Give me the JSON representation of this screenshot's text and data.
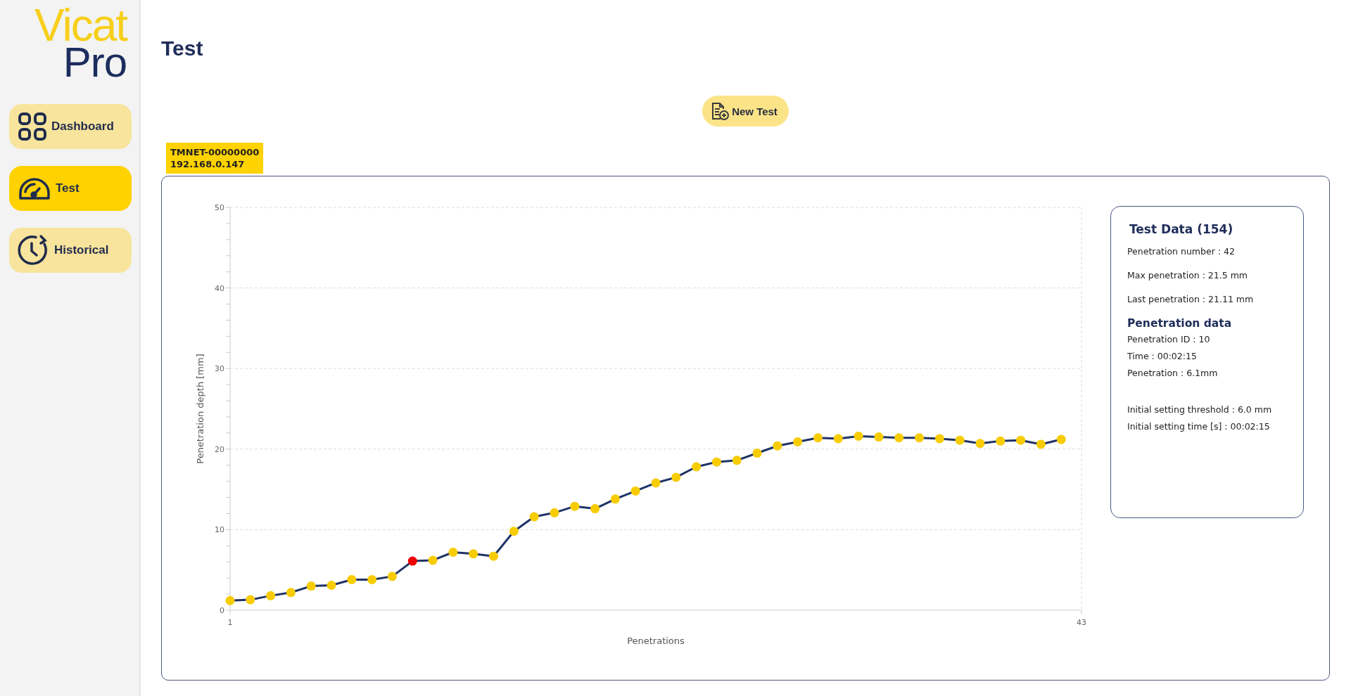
{
  "logo": {
    "line_1": "Vicat",
    "line_2": "Pro"
  },
  "sidebar": {
    "items": [
      {
        "label": "Dashboard",
        "selected": false
      },
      {
        "label": "Test",
        "selected": true
      },
      {
        "label": "Historical",
        "selected": false
      }
    ]
  },
  "page": {
    "title": "Test",
    "new_test_button": "New Test"
  },
  "device": {
    "name": "TMNET-00000000",
    "ip": "192.168.0.147"
  },
  "chart": {
    "chart_data": {
      "type": "line",
      "xlabel": "Penetrations",
      "ylabel": "Penetration depth [mm]",
      "x": [
        1,
        2,
        3,
        4,
        5,
        6,
        7,
        8,
        9,
        10,
        11,
        12,
        13,
        14,
        15,
        16,
        17,
        18,
        19,
        20,
        21,
        22,
        23,
        24,
        25,
        26,
        27,
        28,
        29,
        30,
        31,
        32,
        33,
        34,
        35,
        36,
        37,
        38,
        39,
        40,
        41,
        42
      ],
      "series": [
        {
          "color": "#1f3366",
          "marker": "circle",
          "values": [
            1.2,
            1.3,
            1.8,
            2.2,
            3.0,
            3.1,
            3.8,
            3.8,
            4.2,
            6.1,
            6.2,
            7.2,
            7.0,
            6.7,
            9.8,
            11.6,
            12.1,
            12.9,
            12.6,
            13.8,
            14.8,
            15.8,
            16.5,
            17.8,
            18.4,
            18.6,
            19.5,
            20.4,
            20.9,
            21.4,
            21.3,
            21.6,
            21.5,
            21.4,
            21.4,
            21.3,
            21.1,
            20.7,
            21.0,
            21.1,
            20.6,
            21.2
          ]
        },
        {
          "color": "#ee0000",
          "marker": "circle",
          "values": [
            null,
            null,
            null,
            null,
            null,
            null,
            null,
            null,
            null,
            6.1,
            null,
            null,
            null,
            null,
            null,
            null,
            null,
            null,
            null,
            null,
            null,
            null,
            null,
            null,
            null,
            null,
            null,
            null,
            null,
            null,
            null,
            null,
            null,
            null,
            null,
            null,
            null,
            null,
            null,
            null,
            null,
            null
          ]
        }
      ],
      "xlim": [
        1,
        43
      ],
      "ylim": [
        0,
        50
      ],
      "xticks": [
        1,
        43
      ],
      "yticks": [
        0,
        10,
        20,
        30,
        40,
        50
      ],
      "grid": true
    }
  },
  "test_data": {
    "title": "Test Data (154)",
    "summary": [
      "Penetration number : 42",
      "Max penetration : 21.5 mm",
      "Last penetration : 21.11 mm"
    ],
    "penetration_title": "Penetration data",
    "penetration": [
      "Penetration ID : 10",
      "Time : 00:02:15",
      "Penetration : 6.1mm"
    ],
    "setting": [
      "Initial setting threshold : 6.0 mm",
      "Initial setting time [s] : 00:02:15"
    ]
  }
}
